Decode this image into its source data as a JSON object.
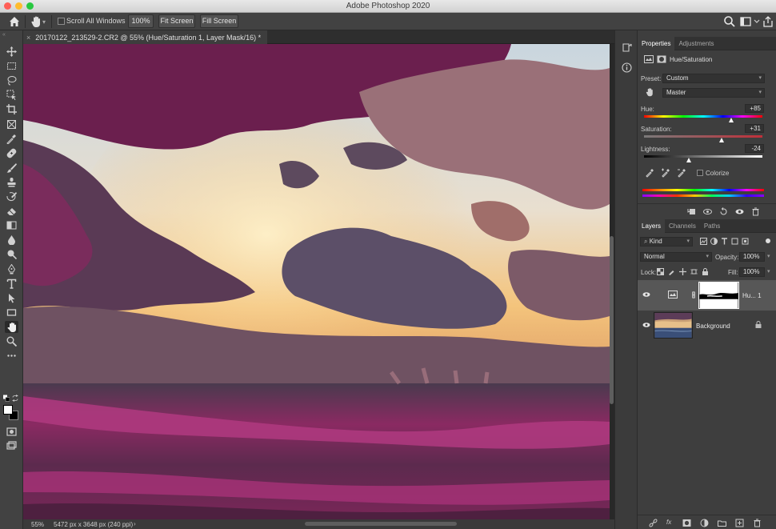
{
  "app": {
    "window_title": "Adobe Photoshop 2020"
  },
  "options_bar": {
    "scroll_all_windows_label": "Scroll All Windows",
    "scroll_all_windows_checked": false,
    "zoom_button": "100%",
    "fit_screen_button": "Fit Screen",
    "fill_screen_button": "Fill Screen"
  },
  "tools": [
    "move-tool",
    "marquee-tool",
    "lasso-tool",
    "object-select-tool",
    "crop-tool",
    "frame-tool",
    "eyedropper-tool",
    "healing-brush-tool",
    "brush-tool",
    "clone-stamp-tool",
    "history-brush-tool",
    "eraser-tool",
    "gradient-tool",
    "blur-tool",
    "dodge-tool",
    "pen-tool",
    "type-tool",
    "path-selection-tool",
    "rectangle-tool",
    "hand-tool",
    "zoom-tool",
    "more-tools"
  ],
  "active_tool": "hand-tool",
  "colors": {
    "foreground": "#ffffff",
    "background": "#000000"
  },
  "document": {
    "tab_title": "20170122_213529-2.CR2 @ 55% (Hue/Saturation 1, Layer Mask/16) *",
    "close_glyph": "×"
  },
  "status": {
    "zoom": "55%",
    "doc_info": "5472 px x 3648 px (240 ppi)",
    "arrow": "›"
  },
  "properties_panel": {
    "tabs": [
      "Properties",
      "Adjustments"
    ],
    "active_tab": "Properties",
    "adjustment_name": "Hue/Saturation",
    "preset_label": "Preset:",
    "preset_value": "Custom",
    "channel_value": "Master",
    "hue_label": "Hue:",
    "hue_value": "+85",
    "saturation_label": "Saturation:",
    "saturation_value": "+31",
    "lightness_label": "Lightness:",
    "lightness_value": "-24",
    "hue_slider_fraction": 0.736,
    "saturation_slider_fraction": 0.655,
    "lightness_slider_fraction": 0.38,
    "colorize_label": "Colorize",
    "colorize_checked": false
  },
  "layers_panel": {
    "tabs": [
      "Layers",
      "Channels",
      "Paths"
    ],
    "active_tab": "Layers",
    "filter_kind": "Kind",
    "blend_mode": "Normal",
    "opacity_label": "Opacity:",
    "opacity_value": "100%",
    "lock_label": "Lock:",
    "fill_label": "Fill:",
    "fill_value": "100%",
    "layers": [
      {
        "name": "Hu... 1",
        "type": "adjustment",
        "visible": true,
        "selected": true
      },
      {
        "name": "Background",
        "type": "pixel",
        "visible": true,
        "selected": false,
        "locked": true
      }
    ]
  },
  "accent": {
    "photo_magenta": "#8a2a62",
    "sunset_gold": "#f3b866",
    "selection_bg": "#575757"
  }
}
